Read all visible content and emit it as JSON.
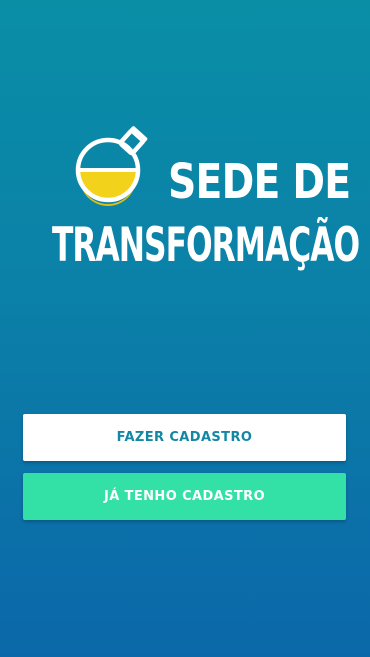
{
  "app": {
    "title_line1": "SEDE DE",
    "title_line2": "TRANSFORMAÇÃO",
    "logo_icon": "flask-icon"
  },
  "actions": {
    "register_label": "FAZER CADASTRO",
    "login_label": "JÁ TENHO CADASTRO"
  },
  "colors": {
    "background_top": "#0a8ea6",
    "background_bottom": "#0b67a9",
    "register_button_bg": "#ffffff",
    "register_button_text": "#1388a3",
    "login_button_bg": "#33e0a6",
    "login_button_text": "#ffffff",
    "flask_liquid": "#f2d21a"
  }
}
